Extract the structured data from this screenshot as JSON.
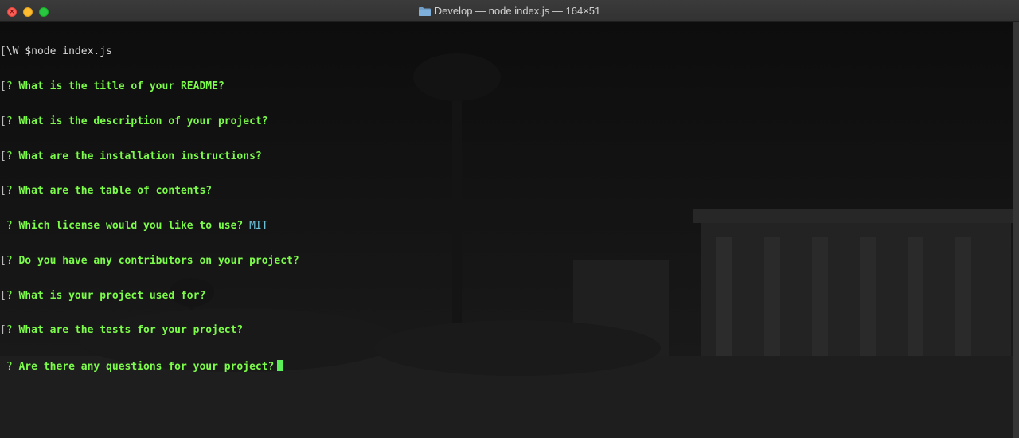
{
  "window": {
    "title": "Develop — node index.js — 164×51",
    "folder_icon": "folder-icon"
  },
  "terminal": {
    "command_line": {
      "prefix": "[",
      "prompt": "\\W $",
      "command": "node index.js"
    },
    "questions": [
      {
        "bracket": "[",
        "mark": "?",
        "text": "What is the title of your README?",
        "answer": ""
      },
      {
        "bracket": "[",
        "mark": "?",
        "text": "What is the description of your project?",
        "answer": ""
      },
      {
        "bracket": "[",
        "mark": "?",
        "text": "What are the installation instructions?",
        "answer": ""
      },
      {
        "bracket": "[",
        "mark": "?",
        "text": "What are the table of contents?",
        "answer": ""
      },
      {
        "bracket": " ",
        "mark": "?",
        "text": "Which license would you like to use?",
        "answer": "MIT"
      },
      {
        "bracket": "[",
        "mark": "?",
        "text": "Do you have any contributors on your project?",
        "answer": ""
      },
      {
        "bracket": "[",
        "mark": "?",
        "text": "What is your project used for?",
        "answer": ""
      },
      {
        "bracket": "[",
        "mark": "?",
        "text": "What are the tests for your project?",
        "answer": ""
      },
      {
        "bracket": " ",
        "mark": "?",
        "text": "Are there any questions for your project?",
        "answer": ""
      }
    ]
  },
  "colors": {
    "question_green": "#7cfc4a",
    "answer_cyan": "#6ec3d9",
    "cursor_green": "#5af158",
    "background": "#0c0c0c"
  }
}
